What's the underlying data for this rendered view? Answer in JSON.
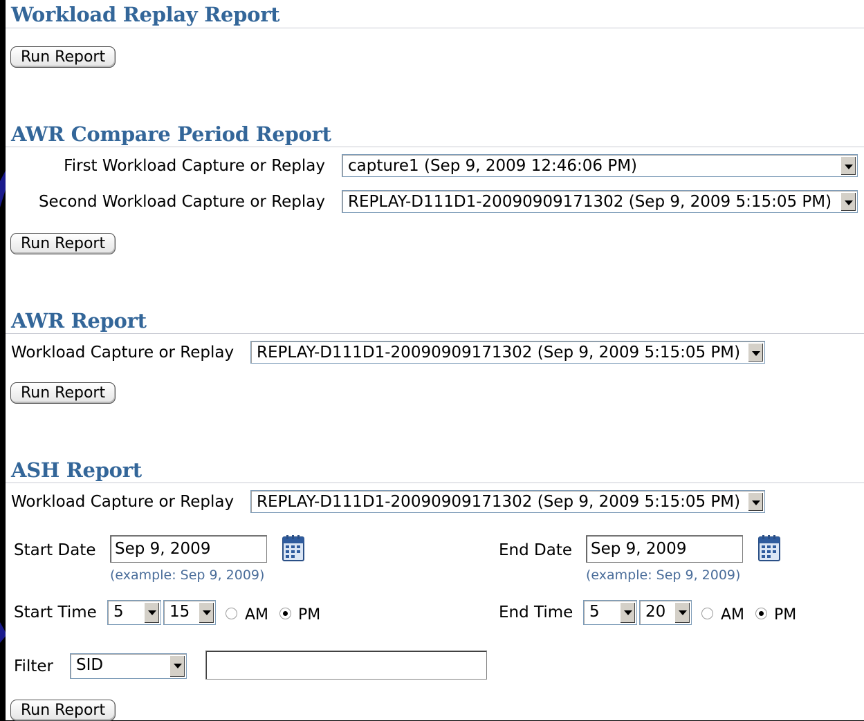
{
  "workload_replay": {
    "title": "Workload Replay Report",
    "run_label": "Run Report"
  },
  "awr_compare": {
    "title": "AWR Compare Period Report",
    "first_label": "First Workload Capture or Replay",
    "first_value": "capture1 (Sep 9, 2009 12:46:06 PM)",
    "second_label": "Second Workload Capture or Replay",
    "second_value": "REPLAY-D111D1-20090909171302 (Sep 9, 2009 5:15:05 PM)",
    "run_label": "Run Report"
  },
  "awr_report": {
    "title": "AWR Report",
    "capture_label": "Workload Capture or Replay",
    "capture_value": "REPLAY-D111D1-20090909171302 (Sep 9, 2009 5:15:05 PM)",
    "run_label": "Run Report"
  },
  "ash_report": {
    "title": "ASH Report",
    "capture_label": "Workload Capture or Replay",
    "capture_value": "REPLAY-D111D1-20090909171302 (Sep 9, 2009 5:15:05 PM)",
    "start_date_label": "Start Date",
    "start_date_value": "Sep 9, 2009",
    "start_date_example": "(example: Sep 9, 2009)",
    "end_date_label": "End Date",
    "end_date_value": "Sep 9, 2009",
    "end_date_example": "(example: Sep 9, 2009)",
    "start_time_label": "Start Time",
    "start_hour": "5",
    "start_minute": "15",
    "end_time_label": "End Time",
    "end_hour": "5",
    "end_minute": "20",
    "am_label": "AM",
    "pm_label": "PM",
    "start_ampm_selected": "PM",
    "end_ampm_selected": "PM",
    "filter_label": "Filter",
    "filter_value": "SID",
    "filter_text": "",
    "run_label": "Run Report"
  },
  "icons": {
    "calendar": "calendar-icon",
    "dropdown": "chevron-down-icon"
  },
  "colors": {
    "heading": "#336699",
    "example_text": "#4a6d9a",
    "frame": "#000000"
  }
}
